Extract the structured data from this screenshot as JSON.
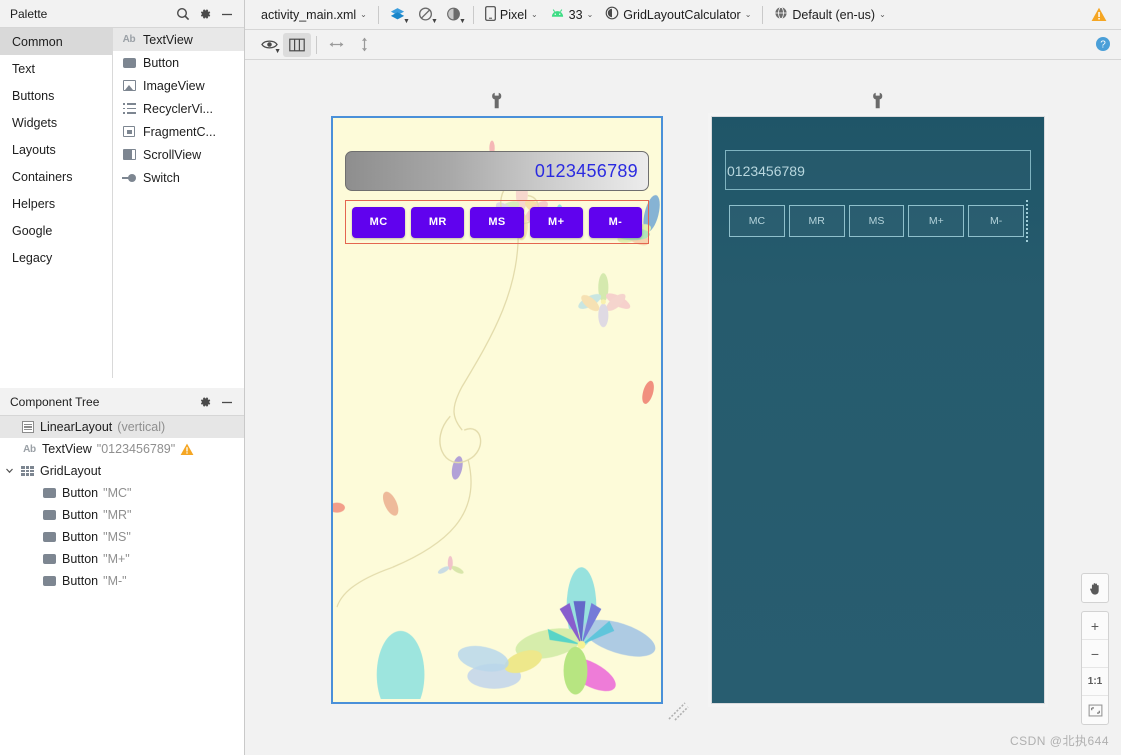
{
  "palette": {
    "title": "Palette",
    "search_icon": "search-icon",
    "gear_icon": "gear-icon",
    "minimize_icon": "minimize-icon",
    "categories": [
      {
        "label": "Common",
        "selected": true
      },
      {
        "label": "Text",
        "selected": false
      },
      {
        "label": "Buttons",
        "selected": false
      },
      {
        "label": "Widgets",
        "selected": false
      },
      {
        "label": "Layouts",
        "selected": false
      },
      {
        "label": "Containers",
        "selected": false
      },
      {
        "label": "Helpers",
        "selected": false
      },
      {
        "label": "Google",
        "selected": false
      },
      {
        "label": "Legacy",
        "selected": false
      }
    ],
    "items": [
      {
        "label": "TextView",
        "icon": "textview-icon",
        "selected": true
      },
      {
        "label": "Button",
        "icon": "button-icon",
        "selected": false
      },
      {
        "label": "ImageView",
        "icon": "imageview-icon",
        "selected": false
      },
      {
        "label": "RecyclerVi...",
        "icon": "recyclerview-icon",
        "selected": false
      },
      {
        "label": "FragmentC...",
        "icon": "fragmentcontainer-icon",
        "selected": false
      },
      {
        "label": "ScrollView",
        "icon": "scrollview-icon",
        "selected": false
      },
      {
        "label": "Switch",
        "icon": "switch-icon",
        "selected": false
      }
    ]
  },
  "component_tree": {
    "title": "Component Tree",
    "gear_icon": "gear-icon",
    "minimize_icon": "minimize-icon",
    "rows": [
      {
        "name": "LinearLayout",
        "sub": "(vertical)",
        "icon": "linearlayout-icon",
        "indent": 0,
        "selected": true,
        "chevron": "",
        "warning": false
      },
      {
        "name": "TextView",
        "sub": "\"0123456789\"",
        "icon": "textview-icon",
        "indent": 1,
        "selected": false,
        "chevron": "",
        "warning": true
      },
      {
        "name": "GridLayout",
        "sub": "",
        "icon": "gridlayout-icon",
        "indent": 0,
        "selected": false,
        "chevron": "v",
        "warning": false
      },
      {
        "name": "Button",
        "sub": "\"MC\"",
        "icon": "button-icon",
        "indent": 2,
        "selected": false,
        "chevron": "",
        "warning": false
      },
      {
        "name": "Button",
        "sub": "\"MR\"",
        "icon": "button-icon",
        "indent": 2,
        "selected": false,
        "chevron": "",
        "warning": false
      },
      {
        "name": "Button",
        "sub": "\"MS\"",
        "icon": "button-icon",
        "indent": 2,
        "selected": false,
        "chevron": "",
        "warning": false
      },
      {
        "name": "Button",
        "sub": "\"M+\"",
        "icon": "button-icon",
        "indent": 2,
        "selected": false,
        "chevron": "",
        "warning": false
      },
      {
        "name": "Button",
        "sub": "\"M-\"",
        "icon": "button-icon",
        "indent": 2,
        "selected": false,
        "chevron": "",
        "warning": false
      }
    ]
  },
  "toolbar": {
    "file_name": "activity_main.xml",
    "design_mode_icon": "layers-icon",
    "orientation_icon": "rotate-icon",
    "theme_icon": "theme-contrast-icon",
    "device_icon": "phone-icon",
    "device_name": "Pixel",
    "api_icon": "android-icon",
    "api_level": "33",
    "theme_select_icon": "contrast-circle-icon",
    "theme_name": "GridLayoutCalculator",
    "locale_icon": "globe-icon",
    "locale_name": "Default (en-us)",
    "warning_icon": "warning-icon",
    "caret": "⌄"
  },
  "subbar": {
    "eye_icon": "eye-visibility-icon",
    "columns_icon": "blueprint-columns-icon",
    "width_icon": "horizontal-resize-icon",
    "height_icon": "vertical-resize-icon",
    "help_icon": "help-icon"
  },
  "preview": {
    "wrench_icon": "wrench-icon",
    "resize_icon": "resize-corner-icon",
    "textview_value": "0123456789",
    "buttons": [
      "MC",
      "MR",
      "MS",
      "M+",
      "M-"
    ],
    "colors": {
      "screen_bg": "#fdfbd9",
      "button_purple": "#6002ee",
      "textview_text": "#2b2be0",
      "selection_blue": "#4a90d9",
      "gridlayout_outline": "#e4664f",
      "blueprint_bg": "#265b6d",
      "blueprint_stroke": "#8fc0cc"
    }
  },
  "zoom_controls": {
    "pan_icon": "hand-pan-icon",
    "zoom_in": "+",
    "zoom_out": "−",
    "actual_size": "1:1",
    "fit_screen_icon": "fit-screen-icon"
  },
  "watermark": "CSDN @北执644"
}
